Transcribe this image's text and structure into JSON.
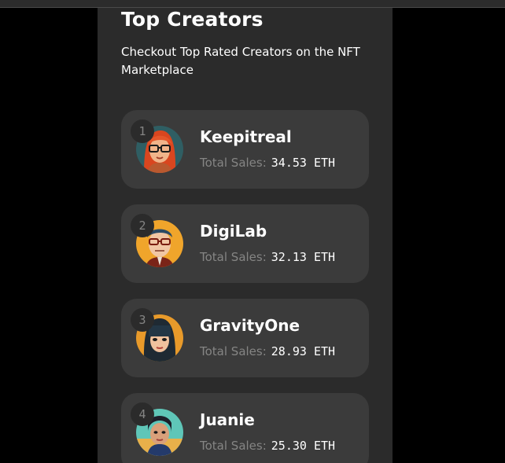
{
  "section": {
    "title": "Top Creators",
    "subtitle": "Checkout Top Rated Creators on the NFT Marketplace"
  },
  "creators": [
    {
      "rank": "1",
      "name": "Keepitreal",
      "sales_label": "Total Sales:",
      "sales_value": "34.53 ETH",
      "avatar_icon": "red-haired-woman-avatar"
    },
    {
      "rank": "2",
      "name": "DigiLab",
      "sales_label": "Total Sales:",
      "sales_value": "32.13 ETH",
      "avatar_icon": "man-with-glasses-avatar"
    },
    {
      "rank": "3",
      "name": "GravityOne",
      "sales_label": "Total Sales:",
      "sales_value": "28.93 ETH",
      "avatar_icon": "dark-haired-woman-avatar"
    },
    {
      "rank": "4",
      "name": "Juanie",
      "sales_label": "Total Sales:",
      "sales_value": "25.30 ETH",
      "avatar_icon": "woman-in-scarf-avatar"
    }
  ],
  "colors": {
    "page_background": "#000000",
    "panel_background": "#2b2b2b",
    "card_background": "#3b3b3b",
    "muted_text": "#858584",
    "text": "#ffffff"
  }
}
